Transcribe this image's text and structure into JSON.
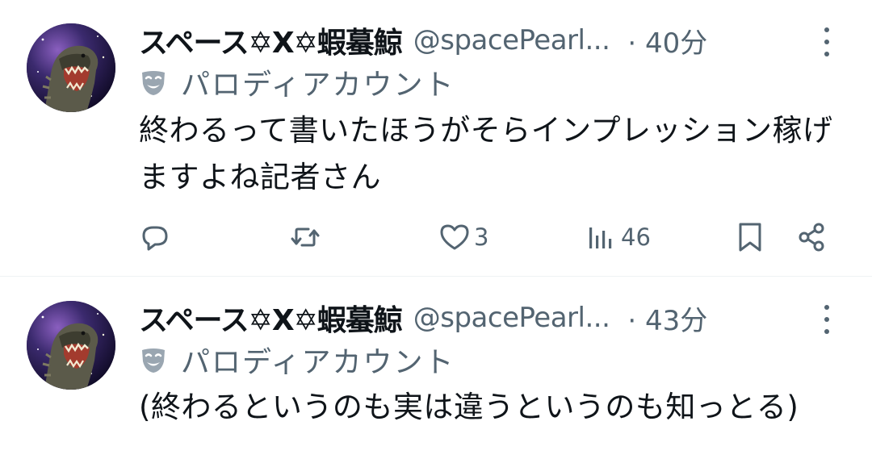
{
  "tweets": [
    {
      "display_name": "スペース✡X✡蝦蟇鯨",
      "handle": "@spacePearl...",
      "time": "· 40分",
      "label": "パロディアカウント",
      "text": "終わるって書いたほうがそらインプレッション稼げますよね記者さん",
      "reply_count": "",
      "retweet_count": "",
      "like_count": "3",
      "view_count": "46"
    },
    {
      "display_name": "スペース✡X✡蝦蟇鯨",
      "handle": "@spacePearl...",
      "time": "· 43分",
      "label": "パロディアカウント",
      "text": "(終わるというのも実は違うというのも知っとる)"
    }
  ],
  "icons": {
    "avatar": "kaiju-avatar",
    "label": "theater-mask-icon",
    "more": "more-vertical-icon",
    "reply": "reply-icon",
    "retweet": "retweet-icon",
    "like": "heart-icon",
    "views": "views-icon",
    "bookmark": "bookmark-icon",
    "share": "share-icon"
  },
  "colors": {
    "text_primary": "#0f1419",
    "text_secondary": "#536471",
    "divider": "#eff3f4"
  }
}
